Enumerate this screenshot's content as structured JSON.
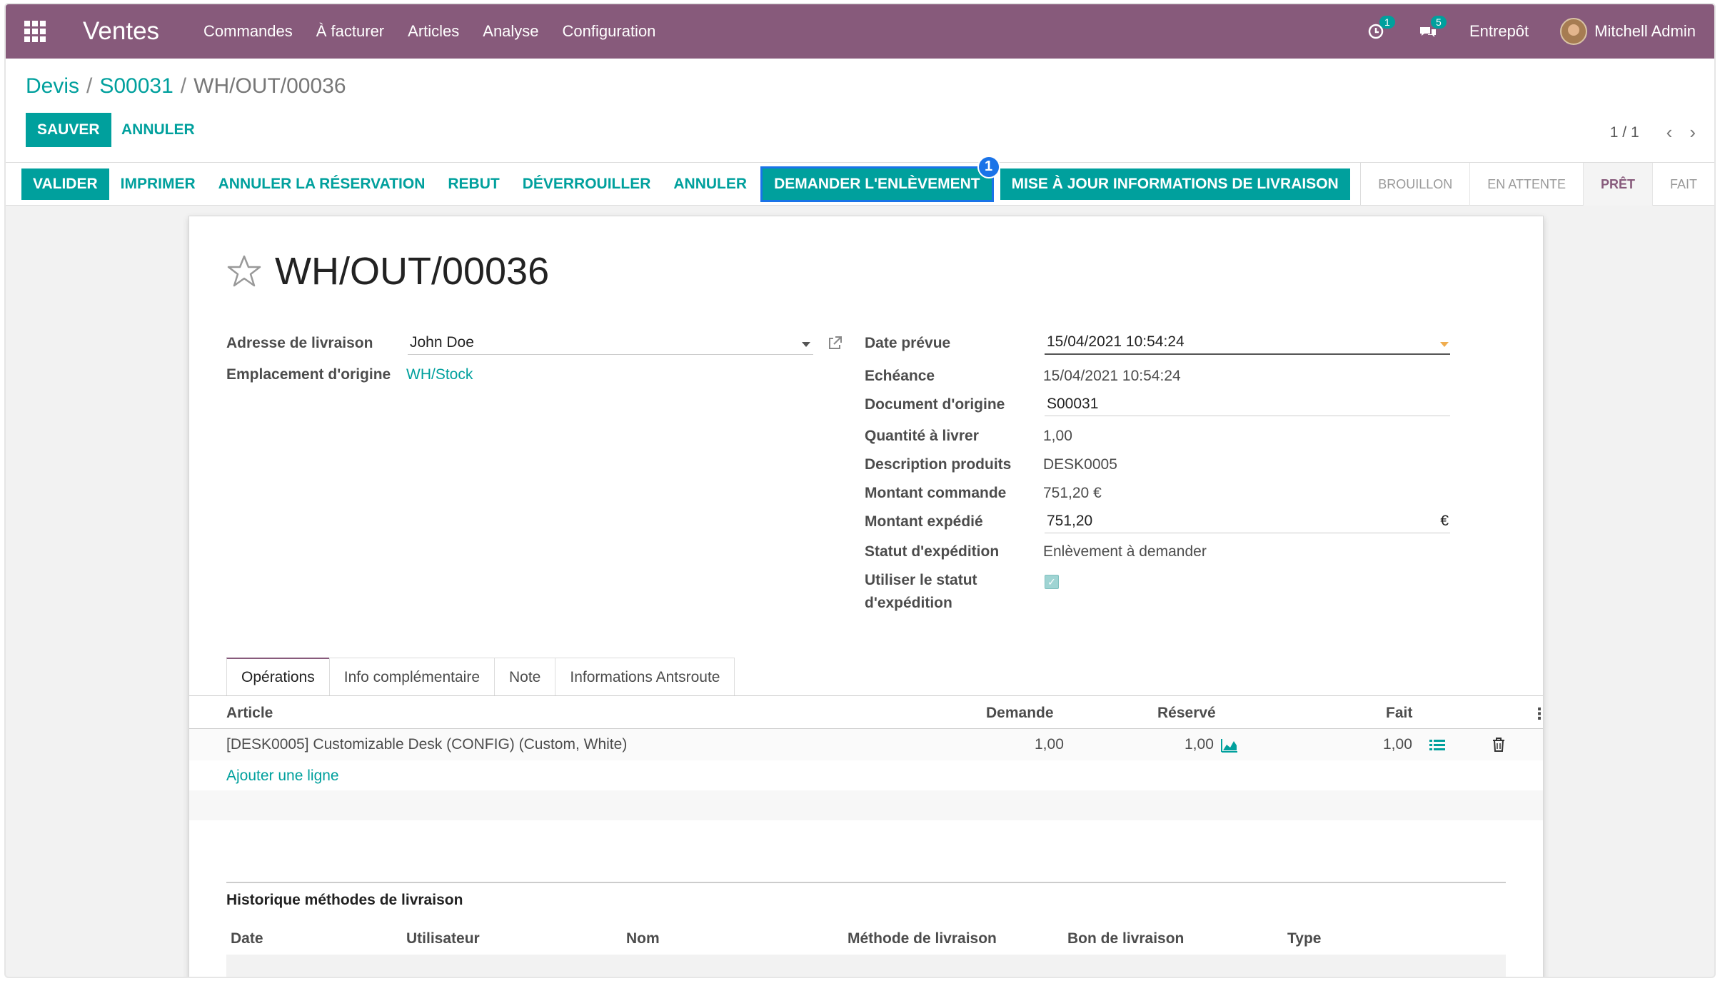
{
  "navbar": {
    "brand": "Ventes",
    "menu": [
      "Commandes",
      "À facturer",
      "Articles",
      "Analyse",
      "Configuration"
    ],
    "activity_count": "1",
    "messages_count": "5",
    "company": "Entrepôt",
    "user": "Mitchell Admin"
  },
  "breadcrumb": {
    "root": "Devis",
    "parent": "S00031",
    "current": "WH/OUT/00036"
  },
  "actions": {
    "save": "SAUVER",
    "discard": "ANNULER"
  },
  "pager": {
    "value": "1 / 1"
  },
  "statusbar": {
    "buttons": [
      "VALIDER",
      "IMPRIMER",
      "ANNULER LA RÉSERVATION",
      "REBUT",
      "DÉVERROUILLER",
      "ANNULER",
      "DEMANDER L'ENLÈVEMENT",
      "MISE À JOUR INFORMATIONS DE LIVRAISON"
    ],
    "highlight_step": "1",
    "stages": [
      "BROUILLON",
      "EN ATTENTE",
      "PRÊT",
      "FAIT"
    ],
    "active_stage": "PRÊT"
  },
  "record": {
    "title": "WH/OUT/00036",
    "left_fields": {
      "delivery_address_label": "Adresse de livraison",
      "delivery_address_value": "John Doe",
      "source_location_label": "Emplacement d'origine",
      "source_location_value": "WH/Stock"
    },
    "right_fields": {
      "scheduled_date_label": "Date prévue",
      "scheduled_date_value": "15/04/2021 10:54:24",
      "deadline_label": "Echéance",
      "deadline_value": "15/04/2021 10:54:24",
      "origin_label": "Document d'origine",
      "origin_value": "S00031",
      "qty_label": "Quantité à livrer",
      "qty_value": "1,00",
      "desc_label": "Description produits",
      "desc_value": "DESK0005",
      "order_amount_label": "Montant commande",
      "order_amount_value": "751,20 €",
      "shipped_amount_label": "Montant expédié",
      "shipped_amount_value": "751,20",
      "shipped_amount_currency": "€",
      "ship_status_label": "Statut d'expédition",
      "ship_status_value": "Enlèvement à demander",
      "use_status_label_1": "Utiliser le statut",
      "use_status_label_2": "d'expédition",
      "use_status_checked": true
    }
  },
  "tabs": [
    "Opérations",
    "Info complémentaire",
    "Note",
    "Informations Antsroute"
  ],
  "operations": {
    "headers": {
      "article": "Article",
      "demand": "Demande",
      "reserved": "Réservé",
      "done": "Fait"
    },
    "rows": [
      {
        "article": "[DESK0005] Customizable Desk (CONFIG) (Custom, White)",
        "demand": "1,00",
        "reserved": "1,00",
        "done": "1,00"
      }
    ],
    "add_line": "Ajouter une ligne"
  },
  "history": {
    "title": "Historique méthodes de livraison",
    "headers": [
      "Date",
      "Utilisateur",
      "Nom",
      "Méthode de livraison",
      "Bon de livraison",
      "Type"
    ]
  },
  "colors": {
    "navbar": "#875a7b",
    "accent": "#00a09d",
    "highlight_outline": "#1a73e8"
  }
}
